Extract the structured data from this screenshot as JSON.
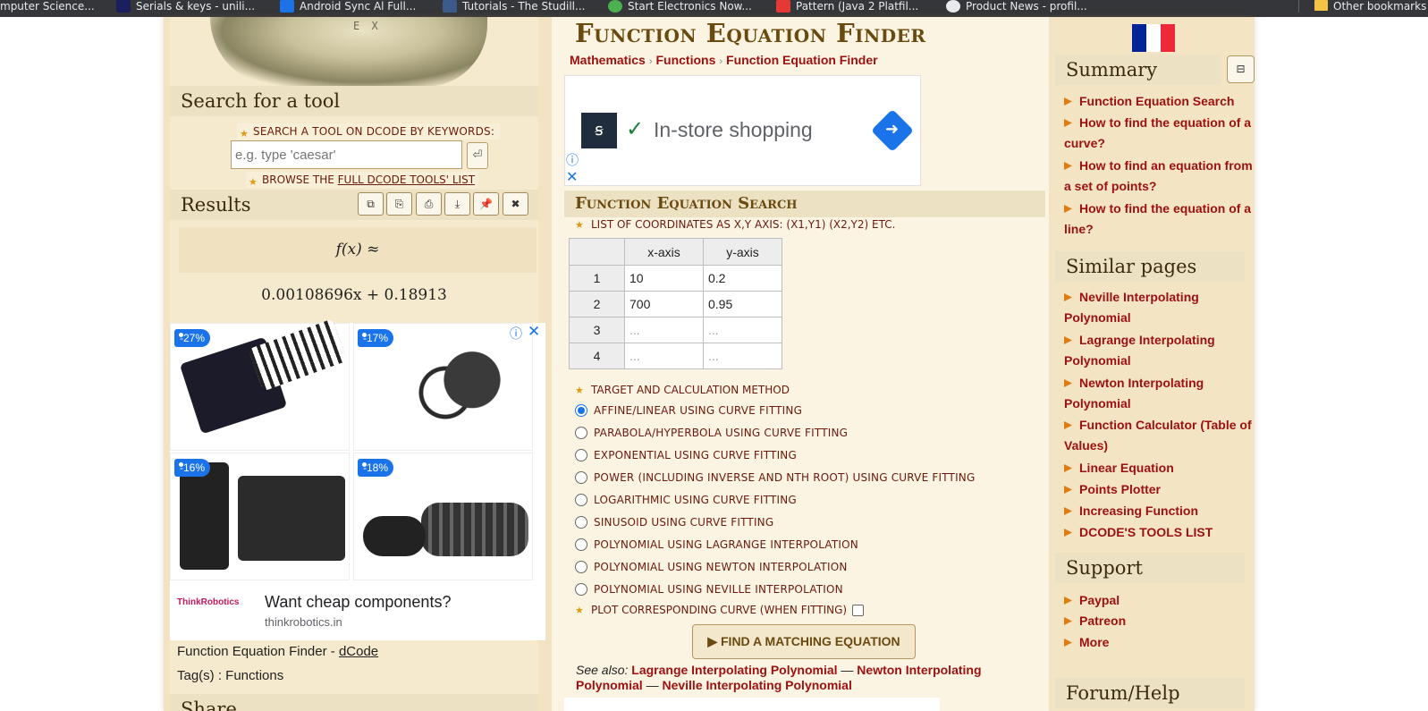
{
  "bookmarks": [
    {
      "label": "mputer Science..."
    },
    {
      "label": "Serials & keys - unili..."
    },
    {
      "label": "Android Sync Al Full..."
    },
    {
      "label": "Tutorials - The Studill..."
    },
    {
      "label": "Start Electronics Now..."
    },
    {
      "label": "Pattern (Java 2 Platfil..."
    },
    {
      "label": "Product News - profil..."
    },
    {
      "label": "Other bookmarks"
    }
  ],
  "left": {
    "lock_letters": "E X",
    "search_title": "Search for a tool",
    "search_label": "SEARCH A TOOL ON DCODE BY KEYWORDS:",
    "search_placeholder": "e.g. type 'caesar'",
    "search_go": "⏎",
    "browse_prefix": "BROWSE THE ",
    "browse_link": "FULL DCODE TOOLS' LIST",
    "results_title": "Results",
    "result_tools": [
      "⧉",
      "⎘",
      "⎙",
      "⤓",
      "📌",
      "✖"
    ],
    "formula_label": "f(x) ≈",
    "formula_value": "0.00108696x + 0.18913",
    "ad": {
      "badges": [
        "-27%",
        "-17%",
        "-16%",
        "-18%"
      ],
      "brand": "ThinkRobotics",
      "headline": "Want cheap components?",
      "url": "thinkrobotics.in"
    },
    "footer_title_prefix": "Function Equation Finder - ",
    "footer_title_link": "dCode",
    "tags": "Tag(s) : Functions",
    "share_title": "Share"
  },
  "main": {
    "title": "Function Equation Finder",
    "breadcrumbs": [
      "Mathematics",
      "Functions",
      "Function Equation Finder"
    ],
    "ad_banner": {
      "logo": "ꞩ",
      "text": "In-store shopping"
    },
    "panel_title": "Function Equation Search",
    "coords_label": "LIST OF COORDINATES AS X,Y AXIS: (X1,Y1) (X2,Y2) ETC.",
    "table": {
      "headers": [
        "",
        "x-axis",
        "y-axis"
      ],
      "rows": [
        {
          "idx": "1",
          "x": "10",
          "y": "0.2"
        },
        {
          "idx": "2",
          "x": "700",
          "y": "0.95"
        },
        {
          "idx": "3",
          "x": "...",
          "y": "..."
        },
        {
          "idx": "4",
          "x": "...",
          "y": "..."
        }
      ]
    },
    "method_label": "TARGET AND CALCULATION METHOD",
    "methods": [
      {
        "label": "AFFINE/LINEAR USING CURVE FITTING",
        "selected": true
      },
      {
        "label": "PARABOLA/HYPERBOLA USING CURVE FITTING",
        "selected": false
      },
      {
        "label": "EXPONENTIAL USING CURVE FITTING",
        "selected": false
      },
      {
        "label": "POWER (INCLUDING INVERSE AND NTH ROOT) USING CURVE FITTING",
        "selected": false
      },
      {
        "label": "LOGARITHMIC USING CURVE FITTING",
        "selected": false
      },
      {
        "label": "SINUSOID USING CURVE FITTING",
        "selected": false
      },
      {
        "label": "POLYNOMIAL USING LAGRANGE INTERPOLATION",
        "selected": false
      },
      {
        "label": "POLYNOMIAL USING NEWTON INTERPOLATION",
        "selected": false
      },
      {
        "label": "POLYNOMIAL USING NEVILLE INTERPOLATION",
        "selected": false
      }
    ],
    "plot_label": "PLOT CORRESPONDING CURVE (WHEN FITTING)",
    "find_button": "FIND A MATCHING EQUATION",
    "see_also_prefix": "See also: ",
    "see_also": [
      "Lagrange Interpolating Polynomial",
      "Newton Interpolating Polynomial",
      "Neville Interpolating Polynomial"
    ],
    "see_also_sep": " — "
  },
  "right": {
    "summary_title": "Summary",
    "collapse": "⊟",
    "summary_items": [
      "Function Equation Search",
      "How to find the equation of a curve?",
      "How to find an equation from a set of points?",
      "How to find the equation of a line?"
    ],
    "similar_title": "Similar pages",
    "similar_items": [
      "Neville Interpolating Polynomial",
      "Lagrange Interpolating Polynomial",
      "Newton Interpolating Polynomial",
      "Function Calculator (Table of Values)",
      "Linear Equation",
      "Points Plotter",
      "Increasing Function",
      "DCODE'S TOOLS LIST"
    ],
    "support_title": "Support",
    "support_items": [
      "Paypal",
      "Patreon",
      "More"
    ],
    "forum_title": "Forum/Help"
  },
  "colors": {
    "accent_red": "#9c1010",
    "title_brown": "#6b4a10",
    "ad_blue": "#1a73e8",
    "flag": [
      "#002395",
      "#ffffff",
      "#ed2939"
    ]
  }
}
